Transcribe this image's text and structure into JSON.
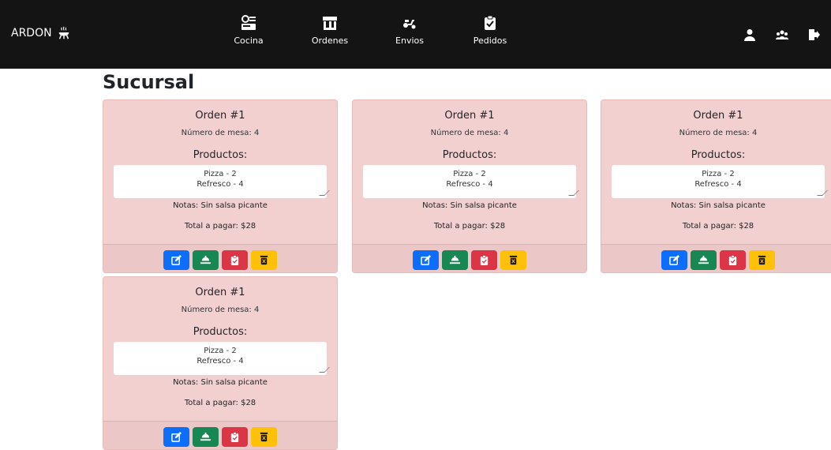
{
  "brand": {
    "name": "ARDON",
    "icon": "grill-icon"
  },
  "nav": {
    "items": [
      {
        "label": "Cocina",
        "icon": "kitchen-icon"
      },
      {
        "label": "Ordenes",
        "icon": "store-icon"
      },
      {
        "label": "Envios",
        "icon": "delivery-icon"
      },
      {
        "label": "Pedidos",
        "icon": "clipboard-check-icon"
      }
    ],
    "right_icons": [
      "user-icon",
      "users-icon",
      "logout-icon"
    ]
  },
  "page": {
    "title": "Sucursal"
  },
  "orders": [
    {
      "title": "Orden #1",
      "mesa": "Número de mesa: 4",
      "products_heading": "Productos:",
      "product1": "Pizza - 2",
      "product2": "Refresco - 4",
      "notas": "Notas: Sin salsa picante",
      "total": "Total a pagar: $28"
    },
    {
      "title": "Orden #1",
      "mesa": "Número de mesa: 4",
      "products_heading": "Productos:",
      "product1": "Pizza - 2",
      "product2": "Refresco - 4",
      "notas": "Notas: Sin salsa picante",
      "total": "Total a pagar: $28"
    },
    {
      "title": "Orden #1",
      "mesa": "Número de mesa: 4",
      "products_heading": "Productos:",
      "product1": "Pizza - 2",
      "product2": "Refresco - 4",
      "notas": "Notas: Sin salsa picante",
      "total": "Total a pagar: $28"
    },
    {
      "title": "Orden #1",
      "mesa": "Número de mesa: 4",
      "products_heading": "Productos:",
      "product1": "Pizza - 2",
      "product2": "Refresco - 4",
      "notas": "Notas: Sin salsa picante",
      "total": "Total a pagar: $28"
    }
  ],
  "actions": [
    {
      "icon": "edit-icon",
      "color": "#0d6efd"
    },
    {
      "icon": "serve-icon",
      "color": "#198754"
    },
    {
      "icon": "clipboard-icon",
      "color": "#dc3545"
    },
    {
      "icon": "trash-icon",
      "color": "#ffc107"
    }
  ],
  "colors": {
    "navbar": "#141414",
    "card_bg": "#f3d0d0"
  }
}
